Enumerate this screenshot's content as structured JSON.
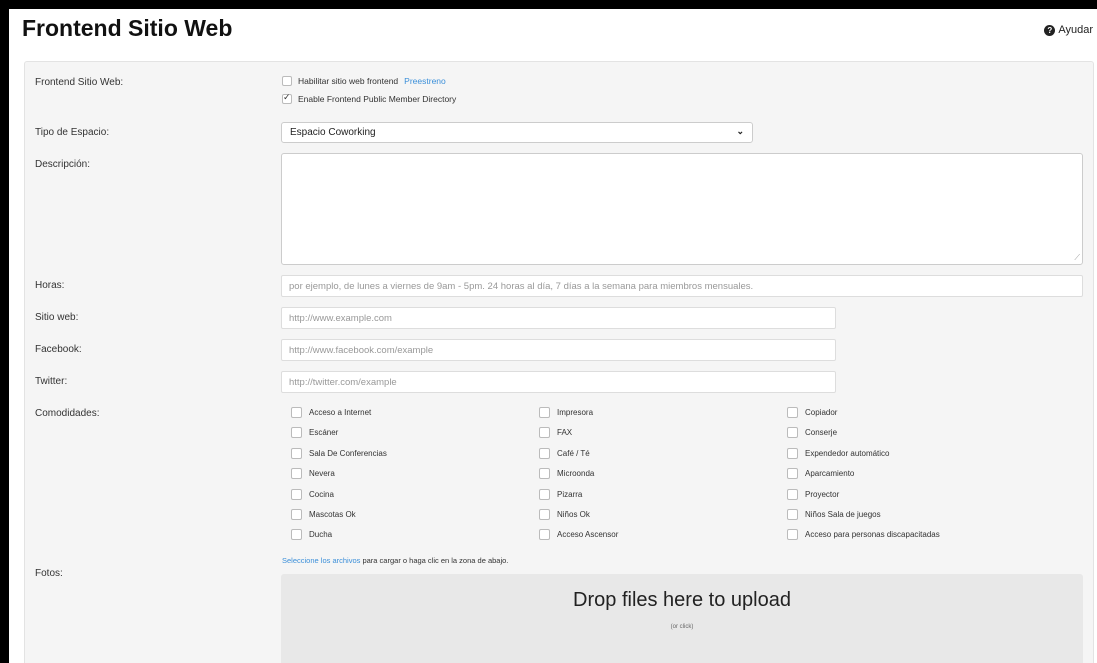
{
  "header": {
    "title": "Frontend Sitio Web",
    "help_label": "Ayudar",
    "help_icon": "question-circle-icon"
  },
  "frontend": {
    "label": "Frontend Sitio Web:",
    "enable_label": "Habilitar sitio web frontend",
    "enable_checked": false,
    "preview_link": "Preestreno",
    "directory_label": "Enable Frontend Public Member Directory",
    "directory_checked": true
  },
  "space_type": {
    "label": "Tipo de Espacio:",
    "value": "Espacio Coworking"
  },
  "description": {
    "label": "Descripción:",
    "value": ""
  },
  "hours": {
    "label": "Horas:",
    "placeholder": "por ejemplo, de lunes a viernes de 9am - 5pm. 24 horas al día, 7 días a la semana para miembros mensuales."
  },
  "website": {
    "label": "Sitio web:",
    "placeholder": "http://www.example.com"
  },
  "facebook": {
    "label": "Facebook:",
    "placeholder": "http://www.facebook.com/example"
  },
  "twitter": {
    "label": "Twitter:",
    "placeholder": "http://twitter.com/example"
  },
  "amenities": {
    "label": "Comodidades:",
    "columns": [
      [
        "Acceso a Internet",
        "Escáner",
        "Sala De Conferencias",
        "Nevera",
        "Cocina",
        "Mascotas Ok",
        "Ducha"
      ],
      [
        "Impresora",
        "FAX",
        "Café / Té",
        "Microonda",
        "Pizarra",
        "Niños Ok",
        "Acceso Ascensor"
      ],
      [
        "Copiador",
        "Conserje",
        "Expendedor automático",
        "Aparcamiento",
        "Proyector",
        "Niños Sala de juegos",
        "Acceso para personas discapacitadas"
      ]
    ]
  },
  "photos": {
    "label": "Fotos:",
    "select_link": "Seleccione los archivos",
    "hint_rest": " para cargar o haga clic en la zona de abajo.",
    "drop_title": "Drop files here to upload",
    "drop_sub": "(or click)"
  }
}
